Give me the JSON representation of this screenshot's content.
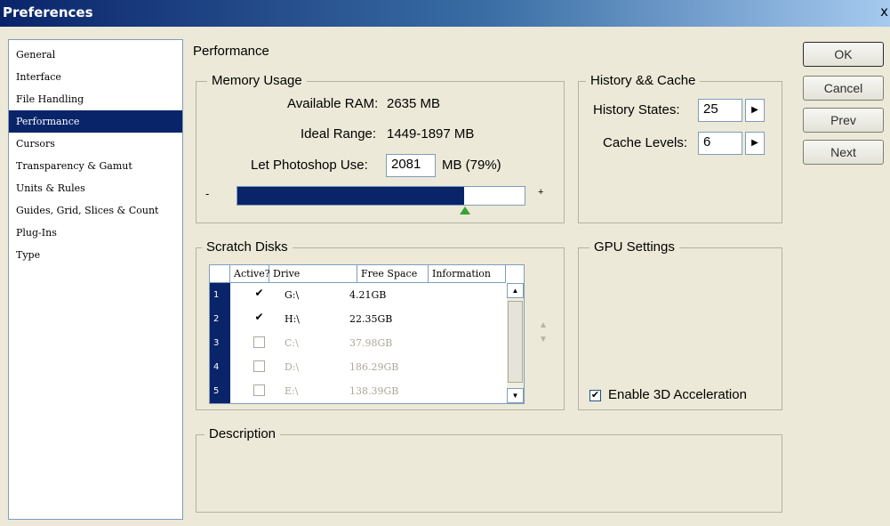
{
  "window": {
    "title": "Preferences",
    "close_glyph": "x"
  },
  "sidebar": {
    "items": [
      {
        "label": "General"
      },
      {
        "label": "Interface"
      },
      {
        "label": "File Handling"
      },
      {
        "label": "Performance"
      },
      {
        "label": "Cursors"
      },
      {
        "label": "Transparency & Gamut"
      },
      {
        "label": "Units & Rules"
      },
      {
        "label": "Guides, Grid, Slices & Count"
      },
      {
        "label": "Plug-Ins"
      },
      {
        "label": "Type"
      }
    ],
    "selected": "Performance"
  },
  "page": {
    "title": "Performance"
  },
  "memory": {
    "legend": "Memory Usage",
    "available_ram_label": "Available RAM:",
    "available_ram_value": "2635 MB",
    "ideal_range_label": "Ideal Range:",
    "ideal_range_value": "1449-1897 MB",
    "let_use_label": "Let Photoshop Use:",
    "let_use_value": "2081",
    "let_use_suffix": "MB (79%)",
    "minus": "-",
    "plus": "+",
    "slider_level": 0.79
  },
  "history_cache": {
    "legend": "History && Cache",
    "history_states_label": "History States:",
    "history_states_value": "25",
    "cache_levels_label": "Cache Levels:",
    "cache_levels_value": "6"
  },
  "scratch_disks": {
    "legend": "Scratch Disks",
    "columns": [
      "Active?",
      "Drive",
      "Free Space",
      "Information"
    ],
    "rows": [
      {
        "num": "1",
        "active": true,
        "drive": "G:\\",
        "free": "4.21GB",
        "info": "",
        "enabled": true
      },
      {
        "num": "2",
        "active": true,
        "drive": "H:\\",
        "free": "22.35GB",
        "info": "",
        "enabled": true
      },
      {
        "num": "3",
        "active": false,
        "drive": "C:\\",
        "free": "37.98GB",
        "info": "",
        "enabled": false
      },
      {
        "num": "4",
        "active": false,
        "drive": "D:\\",
        "free": "186.29GB",
        "info": "",
        "enabled": false
      },
      {
        "num": "5",
        "active": false,
        "drive": "E:\\",
        "free": "138.39GB",
        "info": "",
        "enabled": false
      }
    ]
  },
  "gpu": {
    "legend": "GPU Settings",
    "enable_3d_label": "Enable 3D Acceleration",
    "enable_3d_checked": true
  },
  "description": {
    "legend": "Description",
    "text": ""
  },
  "buttons": {
    "ok": "OK",
    "cancel": "Cancel",
    "prev": "Prev",
    "next": "Next"
  },
  "glyphs": {
    "check": "✔",
    "arrow_right": "▶",
    "arrow_up": "▲",
    "arrow_down": "▼"
  },
  "colors": {
    "selection": "#0a246a",
    "window_bg": "#ece9d8",
    "slider_thumb": "#36a336"
  }
}
